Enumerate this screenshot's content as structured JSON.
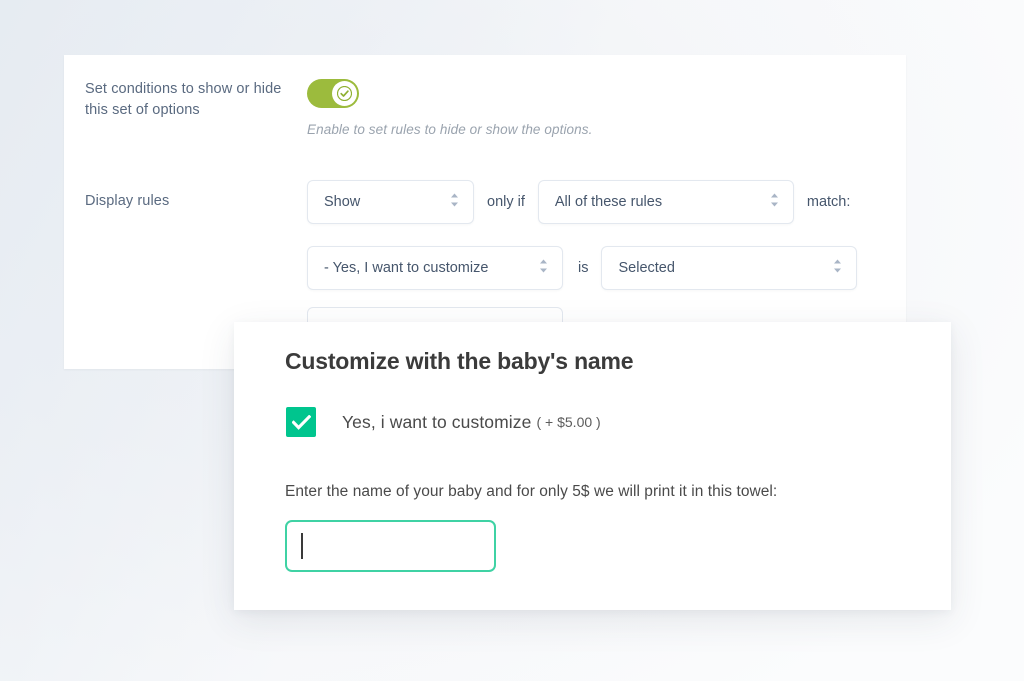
{
  "settings": {
    "conditions": {
      "label": "Set conditions to show or hide this set of options",
      "toggle_state": "on",
      "toggle_color": "#9cbb3d",
      "hint": "Enable to set rules to hide or show the options."
    },
    "display_rules": {
      "label": "Display rules",
      "action_select": "Show",
      "connector_1": "only if",
      "match_select": "All of these rules",
      "connector_2": "match:",
      "condition_rows": [
        {
          "source_select": "- Yes, I want to customize",
          "operator": "is",
          "value_select": "Selected"
        }
      ]
    }
  },
  "preview": {
    "title": "Customize with the baby's name",
    "checkbox": {
      "checked": "true",
      "label": "Yes, i want to customize",
      "price": "( + $5.00 )",
      "color": "#00c58e"
    },
    "help_text": "Enter the name of your baby and for only 5$ we will print it in this towel:",
    "name_input": {
      "value": "",
      "placeholder": "",
      "border_color": "#3fd2a4"
    }
  }
}
